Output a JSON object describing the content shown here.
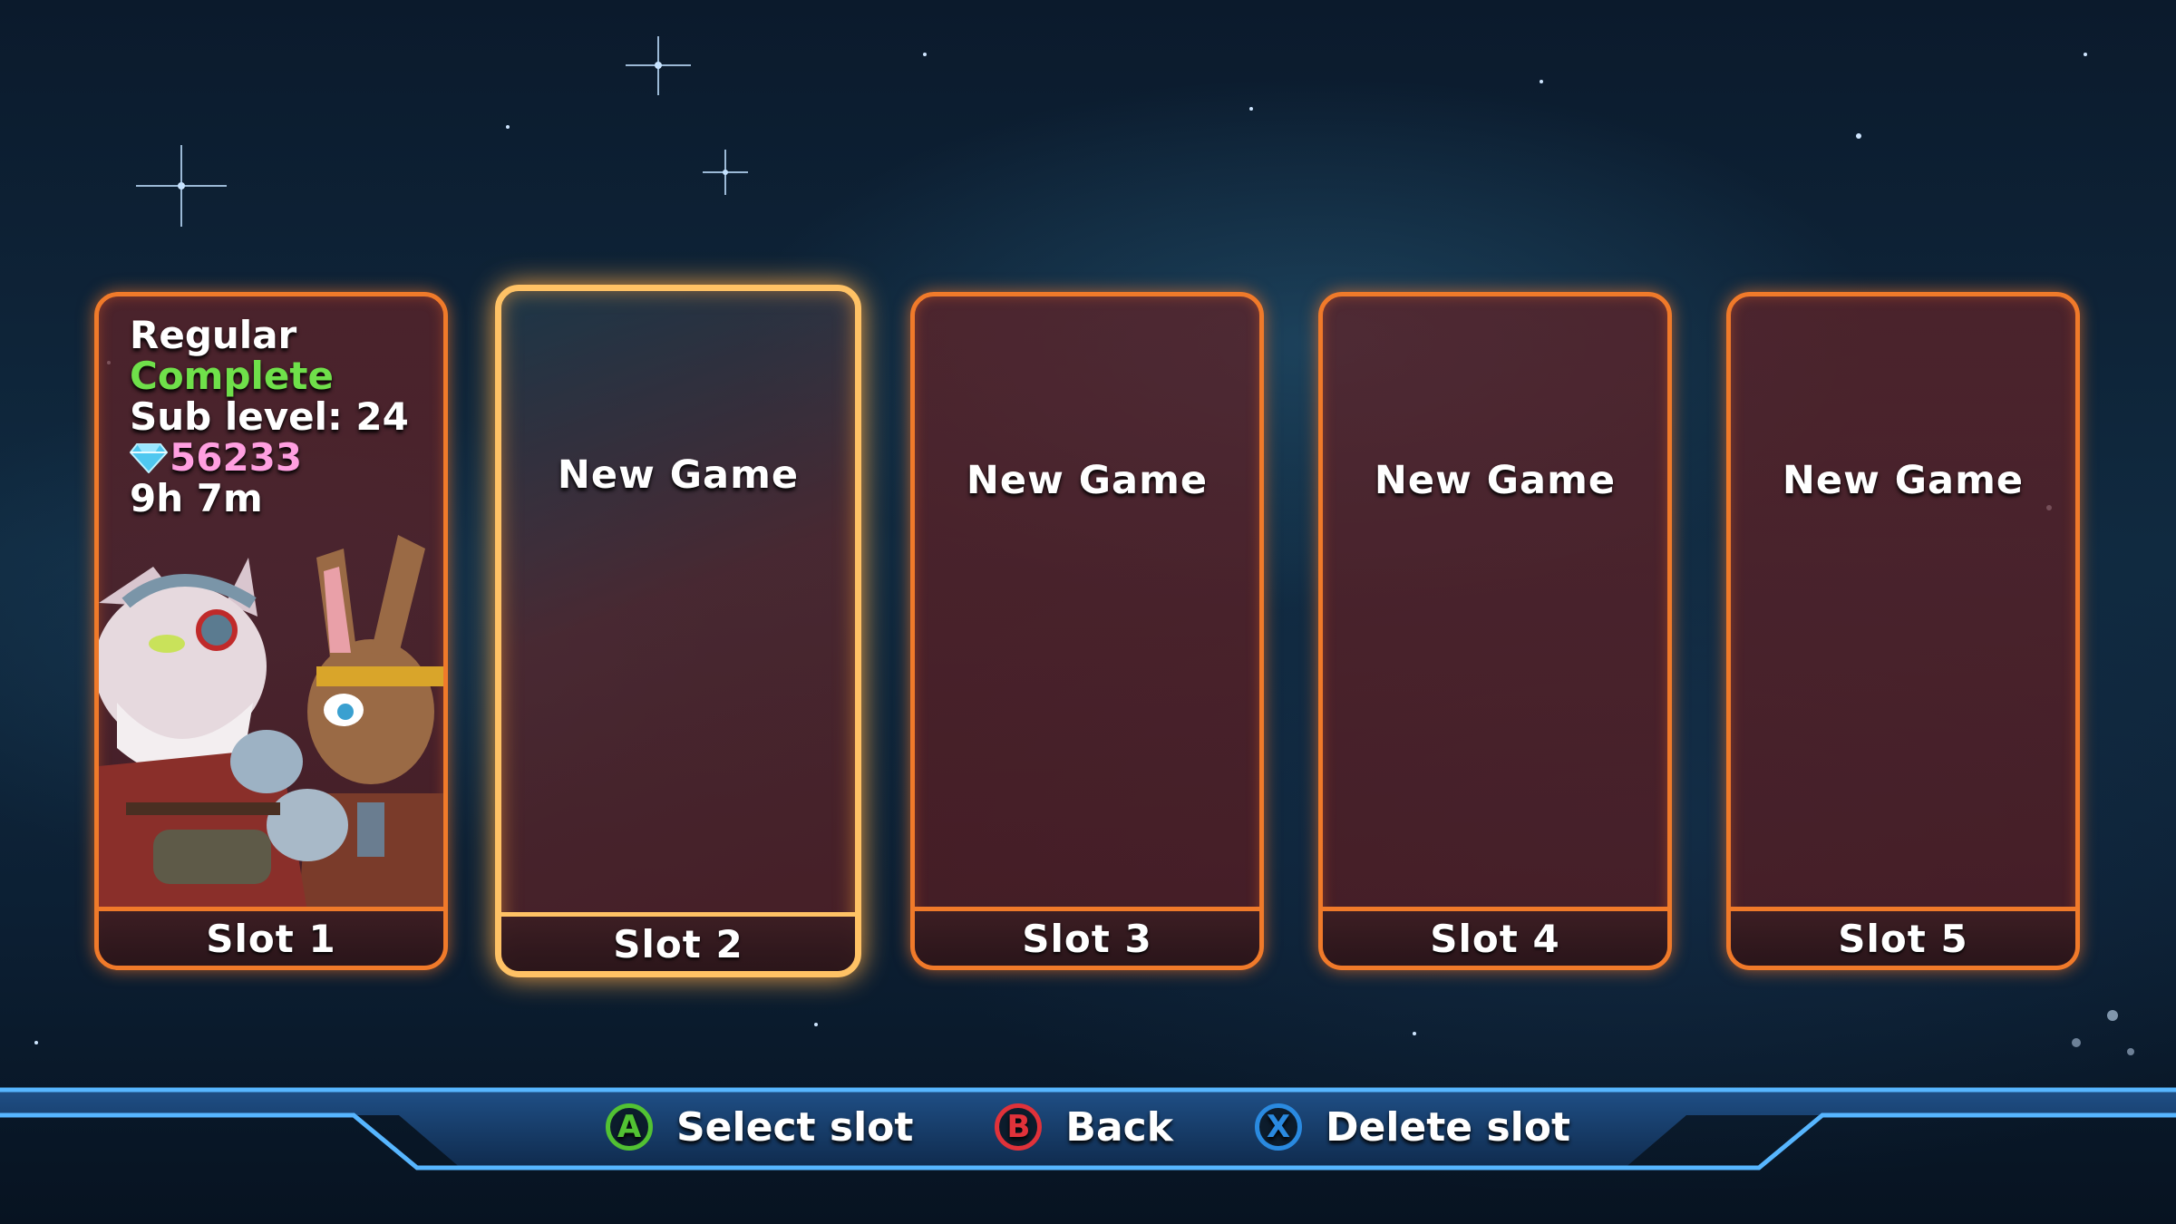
{
  "slots": [
    {
      "label": "Slot 1",
      "difficulty": "Regular",
      "status": "Complete",
      "sub_level": "Sub level: 24",
      "gems": "56233",
      "time": "9h 7m",
      "art_icon": "cat-and-rabbit-heroes"
    },
    {
      "label": "Slot 2",
      "text": "New Game",
      "selected": true
    },
    {
      "label": "Slot 3",
      "text": "New Game"
    },
    {
      "label": "Slot 4",
      "text": "New Game"
    },
    {
      "label": "Slot 5",
      "text": "New Game"
    }
  ],
  "prompts": [
    {
      "button": "A",
      "label": "Select slot",
      "color": "#52c233"
    },
    {
      "button": "B",
      "label": "Back",
      "color": "#e0323a"
    },
    {
      "button": "X",
      "label": "Delete slot",
      "color": "#2a8ae0"
    }
  ],
  "colors": {
    "frame": "#f07a2a",
    "frame_selected": "#ffc265",
    "complete": "#6fe04a",
    "gems": "#ff9fe0"
  }
}
